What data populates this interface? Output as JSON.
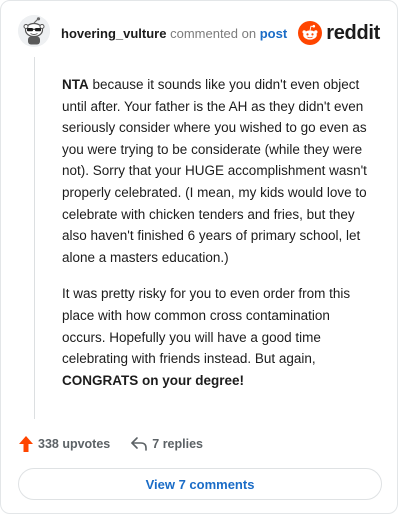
{
  "comment": {
    "username": "hovering_vulture",
    "commented_on": "commented on",
    "post_link": "post",
    "paragraphs": [
      {
        "lead_bold": "NTA",
        "text": " because it sounds like you didn't even object until after. Your father is the AH as they didn't even seriously consider where you wished to go even as you were trying to be considerate (while they were not). Sorry that your HUGE accomplishment wasn't properly celebrated. (I mean, my kids would love to celebrate with chicken tenders and fries, but they also haven't finished 6 years of primary school, let alone a masters education.)"
      },
      {
        "text": "It was pretty risky for you to even order from this place with how common cross contamination occurs. Hopefully you will have a good time celebrating with friends instead. But again, ",
        "trail_bold": "CONGRATS on your degree!"
      }
    ]
  },
  "brand": {
    "wordmark": "reddit",
    "color": "#ff4500"
  },
  "actions": {
    "upvotes_label": "338 upvotes",
    "replies_label": "7 replies",
    "upvote_color": "#ff4500"
  },
  "footer": {
    "view_comments_label": "View 7 comments"
  },
  "icons": [
    "snoo-avatar-icon",
    "reddit-logo-icon",
    "upvote-arrow-icon",
    "reply-arrow-icon"
  ]
}
